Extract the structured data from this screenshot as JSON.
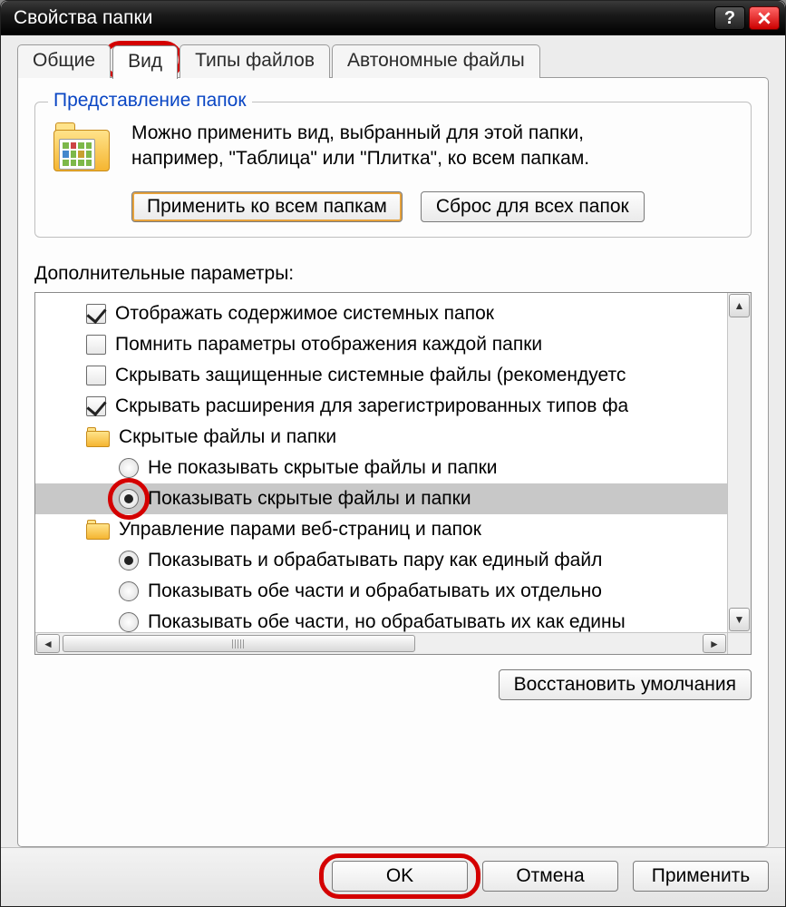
{
  "window": {
    "title": "Свойства папки"
  },
  "tabs": {
    "general": "Общие",
    "view": "Вид",
    "filetypes": "Типы файлов",
    "offline": "Автономные файлы"
  },
  "group": {
    "legend": "Представление папок",
    "text_line1": "Можно применить вид, выбранный для этой папки,",
    "text_line2": "например, \"Таблица\" или \"Плитка\", ко всем папкам.",
    "apply_all": "Применить ко всем папкам",
    "reset_all": "Сброс для всех папок"
  },
  "advanced_label": "Дополнительные параметры:",
  "options": [
    {
      "type": "checkbox",
      "checked": true,
      "level": 1,
      "label": "Отображать содержимое системных папок"
    },
    {
      "type": "checkbox",
      "checked": false,
      "level": 1,
      "label": "Помнить параметры отображения каждой папки"
    },
    {
      "type": "checkbox",
      "checked": false,
      "level": 1,
      "label": "Скрывать защищенные системные файлы (рекомендуетс"
    },
    {
      "type": "checkbox",
      "checked": true,
      "level": 1,
      "label": "Скрывать расширения для зарегистрированных типов фа"
    },
    {
      "type": "folder",
      "level": 1,
      "label": "Скрытые файлы и папки"
    },
    {
      "type": "radio",
      "checked": false,
      "level": 2,
      "label": "Не показывать скрытые файлы и папки"
    },
    {
      "type": "radio",
      "checked": true,
      "level": 2,
      "label": "Показывать скрытые файлы и папки",
      "highlighted": true,
      "selected": true
    },
    {
      "type": "folder",
      "level": 1,
      "label": "Управление парами веб-страниц и папок"
    },
    {
      "type": "radio",
      "checked": true,
      "level": 2,
      "label": "Показывать и обрабатывать пару как единый файл"
    },
    {
      "type": "radio",
      "checked": false,
      "level": 2,
      "label": "Показывать обе части и обрабатывать их отдельно"
    },
    {
      "type": "radio",
      "checked": false,
      "level": 2,
      "label": "Показывать обе части, но обрабатывать их как едины"
    }
  ],
  "restore_defaults": "Восстановить умолчания",
  "footer": {
    "ok": "OK",
    "cancel": "Отмена",
    "apply": "Применить"
  }
}
